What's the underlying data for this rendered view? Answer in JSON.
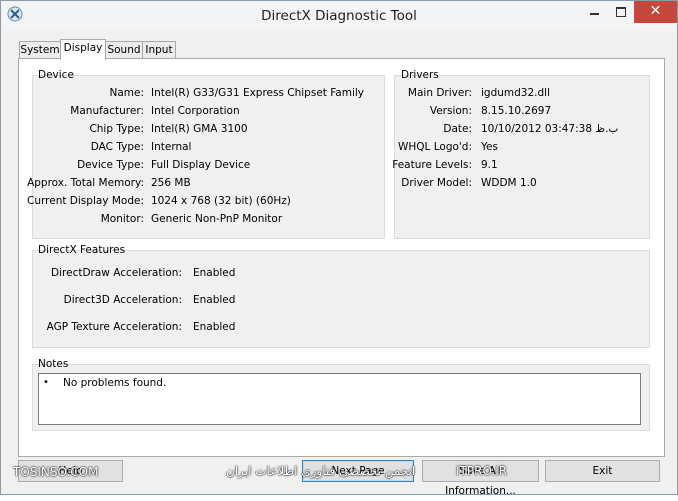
{
  "window": {
    "title": "DirectX Diagnostic Tool",
    "close_glyph": "✕"
  },
  "tabs": [
    {
      "label": "System",
      "active": false
    },
    {
      "label": "Display",
      "active": true
    },
    {
      "label": "Sound",
      "active": false
    },
    {
      "label": "Input",
      "active": false
    }
  ],
  "device": {
    "title": "Device",
    "rows": [
      {
        "label": "Name:",
        "value": "Intel(R) G33/G31 Express Chipset Family"
      },
      {
        "label": "Manufacturer:",
        "value": "Intel Corporation"
      },
      {
        "label": "Chip Type:",
        "value": "Intel(R) GMA 3100"
      },
      {
        "label": "DAC Type:",
        "value": "Internal"
      },
      {
        "label": "Device Type:",
        "value": "Full Display Device"
      },
      {
        "label": "Approx. Total Memory:",
        "value": "256 MB"
      },
      {
        "label": "Current Display Mode:",
        "value": "1024 x 768 (32 bit) (60Hz)"
      },
      {
        "label": "Monitor:",
        "value": "Generic Non-PnP Monitor"
      }
    ]
  },
  "drivers": {
    "title": "Drivers",
    "rows": [
      {
        "label": "Main Driver:",
        "value": "igdumd32.dll"
      },
      {
        "label": "Version:",
        "value": "8.15.10.2697"
      },
      {
        "label": "Date:",
        "value": "10/10/2012 03:47:38 ب.ظ"
      },
      {
        "label": "WHQL Logo'd:",
        "value": "Yes"
      },
      {
        "label": "Feature Levels:",
        "value": "9.1"
      },
      {
        "label": "Driver Model:",
        "value": "WDDM 1.0"
      }
    ]
  },
  "features": {
    "title": "DirectX Features",
    "rows": [
      {
        "label": "DirectDraw Acceleration:",
        "value": "Enabled"
      },
      {
        "label": "Direct3D Acceleration:",
        "value": "Enabled"
      },
      {
        "label": "AGP Texture Acceleration:",
        "value": "Enabled"
      }
    ]
  },
  "notes": {
    "title": "Notes",
    "bullet": "•",
    "items": [
      "No problems found."
    ]
  },
  "buttons": {
    "help": "Help",
    "next": "Next Page",
    "save": "Save All Information...",
    "exit": "Exit"
  },
  "watermark": {
    "left": "TOSINSO.COM",
    "center": "انجمن تخصصی فناوری اطلاعات ایران",
    "right": "ITPRO.IR"
  },
  "colors": {
    "close_button": "#c4483b",
    "primary_button_border": "#3c7fb1"
  }
}
